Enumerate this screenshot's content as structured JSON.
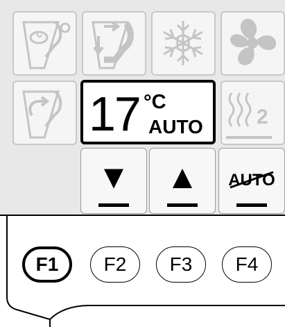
{
  "display": {
    "temperature": "17",
    "unit": "°C",
    "mode": "AUTO"
  },
  "tiles": [
    {
      "icon": "seat-defrost-icon"
    },
    {
      "icon": "seat-airflow-icon"
    },
    {
      "icon": "snowflake-icon"
    },
    {
      "icon": "fan-icon"
    },
    {
      "icon": "seat-recirculation-icon"
    },
    {
      "icon": "seat-heating-icon",
      "level": "2"
    }
  ],
  "keys": {
    "down_glyph": "▼",
    "up_glyph": "▲",
    "auto_off_label": "AUTO"
  },
  "function_keys": [
    {
      "label": "F1",
      "selected": true
    },
    {
      "label": "F2",
      "selected": false
    },
    {
      "label": "F3",
      "selected": false
    },
    {
      "label": "F4",
      "selected": false
    }
  ],
  "colors": {
    "panel_bg": "#e8e8e8",
    "tile_bg": "#f5f5f5",
    "disabled_icon": "#c4c4c4",
    "text": "#000000"
  }
}
